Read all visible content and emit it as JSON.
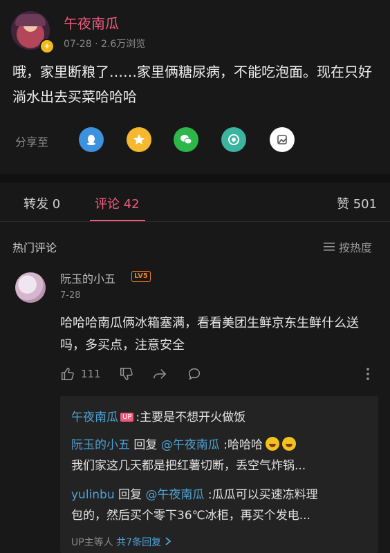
{
  "post": {
    "author": "午夜南瓜",
    "meta": "07-28 · 2.6万浏览",
    "text": "哦，家里断粮了……家里俩糖尿病，不能吃泡面。现在只好淌水出去买菜哈哈哈"
  },
  "share": {
    "label": "分享至",
    "targets": [
      {
        "name": "qq",
        "color": "#3d92e0"
      },
      {
        "name": "qzone",
        "color": "#f5b82e"
      },
      {
        "name": "wechat",
        "color": "#2db649"
      },
      {
        "name": "moments",
        "color": "#3bb5a0"
      },
      {
        "name": "more",
        "color": "#ffffff"
      }
    ]
  },
  "tabs": {
    "forward": "转发 0",
    "comment": "评论 42",
    "like": "赞 501"
  },
  "comments_section": {
    "title": "热门评论",
    "sort_label": "按热度"
  },
  "comment": {
    "user": "阮玉的小五",
    "level": "LV5",
    "date": "7-28",
    "text": "哈哈哈南瓜俩冰箱塞满，看看美团生鲜京东生鲜什么送吗，多买点，注意安全",
    "likes": "111"
  },
  "replies": [
    {
      "user": "午夜南瓜",
      "badge": "UP",
      "text": ":主要是不想开火做饭"
    },
    {
      "user": "阮玉的小五",
      "verb": "回复",
      "mention": "@午夜南瓜",
      "text": ":哈哈哈",
      "text2": "我们家这几天都是把红薯切断，丢空气炸锅..."
    },
    {
      "user": "yulinbu",
      "verb": "回复",
      "mention": "@午夜南瓜",
      "text": ":瓜瓜可以买速冻料理",
      "text2": "包的，然后买个零下36℃冰柜，再买个发电..."
    }
  ],
  "reply_footer": {
    "prefix": "UP主等人",
    "count": "共7条回复"
  }
}
